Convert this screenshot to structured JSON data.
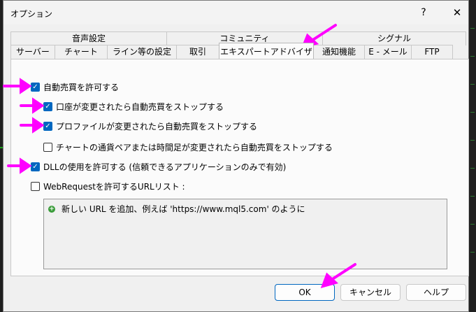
{
  "window": {
    "title": "オプション",
    "help_glyph": "?",
    "close_glyph": "✕"
  },
  "tabs_row1": [
    "音声設定",
    "コミュニティ",
    "シグナル"
  ],
  "tabs_row2": [
    "サーバー",
    "チャート",
    "ライン等の設定",
    "取引",
    "エキスパートアドバイザ",
    "通知機能",
    "E - メール",
    "FTP"
  ],
  "active_tab": "エキスパートアドバイザ",
  "options": {
    "auto_trading": {
      "label": "自動売買を許可する",
      "checked": true
    },
    "stop_on_account_change": {
      "label": "口座が変更されたら自動売買をストップする",
      "checked": true
    },
    "stop_on_profile_change": {
      "label": "プロファイルが変更されたら自動売買をストップする",
      "checked": true
    },
    "stop_on_symbol_change": {
      "label": "チャートの通貨ペアまたは時間足が変更されたら自動売買をストップする",
      "checked": false
    },
    "allow_dll": {
      "label": "DLLの使用を許可する (信頼できるアプリケーションのみで有効)",
      "checked": true
    },
    "allow_webrequest": {
      "label": "WebRequestを許可するURLリスト :",
      "checked": false
    }
  },
  "url_list": {
    "add_hint": "新しい URL を追加、例えば 'https://www.mql5.com' のように"
  },
  "buttons": {
    "ok": "OK",
    "cancel": "キャンセル",
    "help": "ヘルプ"
  },
  "colors": {
    "accent": "#0067c0",
    "annotation_arrow": "#ff00ff",
    "add_icon": "#3a9c3a"
  }
}
